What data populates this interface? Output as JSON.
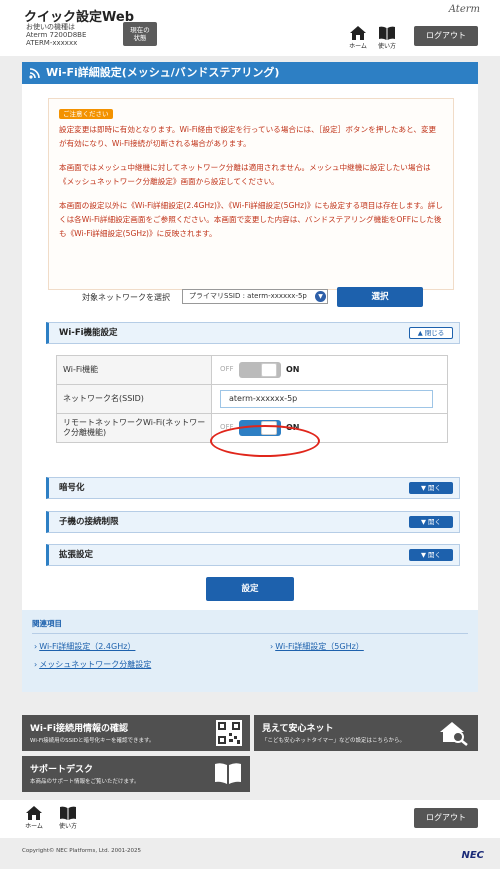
{
  "header": {
    "app_title": "クイック設定Web",
    "device_line1": "お使いの機種は",
    "device_line2": "Aterm 7200D8BE",
    "device_line3": "ATERM-xxxxxx",
    "status_button_line1": "現在の",
    "status_button_line2": "状態",
    "brand": "Aterm",
    "home_label": "ホーム",
    "howto_label": "使い方",
    "logout_label": "ログアウト"
  },
  "page": {
    "title": "Wi-Fi詳細設定(メッシュ/バンドステアリング)"
  },
  "notice": {
    "badge": "ご注意ください",
    "p1": "設定変更は即時に有効となります。Wi-Fi経由で設定を行っている場合には、［設定］ボタンを押したあと、変更が有効になり、Wi-Fi接続が切断される場合があります。",
    "p2": "本画面ではメッシュ中継機に対してネットワーク分離は適用されません。メッシュ中継機に設定したい場合は《メッシュネットワーク分離設定》画面から設定してください。",
    "p3": "本画面の設定以外に《Wi-Fi詳細設定(2.4GHz)》、《Wi-Fi詳細設定(5GHz)》にも設定する項目は存在します。詳しくは各Wi-Fi詳細設定画面をご参照ください。本画面で変更した内容は、バンドステアリング機能をOFFにした後も《Wi-Fi詳細設定(5GHz)》に反映されます。"
  },
  "network_select": {
    "label": "対象ネットワークを選択",
    "value": "プライマリSSID : aterm-xxxxxx-5p",
    "button": "選択"
  },
  "wifi_section": {
    "title": "Wi-Fi機能設定",
    "collapse_label": "閉じる",
    "rows": {
      "wifi_function": {
        "label": "Wi-Fi機能",
        "off": "OFF",
        "on": "ON",
        "state": "off"
      },
      "ssid": {
        "label": "ネットワーク名(SSID)",
        "value": "aterm-xxxxxx-5p"
      },
      "remote": {
        "label": "リモートネットワークWi-Fi(ネットワーク分離機能)",
        "off": "OFF",
        "on": "ON",
        "state": "on"
      }
    }
  },
  "sections": {
    "encryption": {
      "title": "暗号化",
      "open_label": "開く"
    },
    "client_limit": {
      "title": "子機の接続制限",
      "open_label": "開く"
    },
    "extended": {
      "title": "拡張設定",
      "open_label": "開く"
    }
  },
  "apply_button": "設定",
  "related": {
    "title": "関連項目",
    "link_24": "Wi-Fi詳細設定（2.4GHz）",
    "link_5": "Wi-Fi詳細設定（5GHz）",
    "link_mesh": "メッシュネットワーク分離設定"
  },
  "tiles": {
    "wifi_info": {
      "title": "Wi-Fi接続用情報の確認",
      "sub": "Wi-Fi接続用のSSIDと暗号化キーを確認できます。"
    },
    "mieru": {
      "title": "見えて安心ネット",
      "sub": "「こども安心ネットタイマー」などの設定はこちらから。"
    },
    "support": {
      "title": "サポートデスク",
      "sub": "本商品のサポート情報をご覧いただけます。"
    }
  },
  "footer": {
    "home_label": "ホーム",
    "howto_label": "使い方",
    "logout_label": "ログアウト",
    "copyright": "Copyright© NEC Platforms, Ltd. 2001-2025",
    "nec": "NEC"
  }
}
